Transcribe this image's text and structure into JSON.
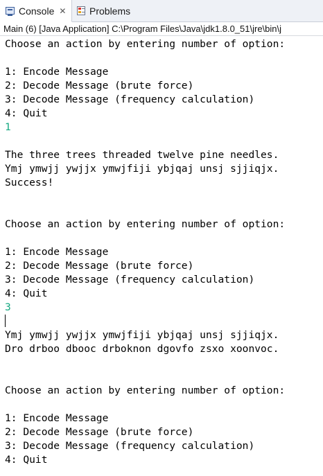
{
  "tabs": [
    {
      "label": "Console",
      "icon": "console-icon",
      "active": true,
      "closable": true
    },
    {
      "label": "Problems",
      "icon": "problems-icon",
      "active": false
    }
  ],
  "process_label": "Main (6) [Java Application] C:\\Program Files\\Java\\jdk1.8.0_51\\jre\\bin\\j",
  "colors": {
    "input_text": "#14a880",
    "output_text": "#000000"
  },
  "console": {
    "lines": [
      {
        "text": "Choose an action by entering number of option:",
        "type": "output"
      },
      {
        "text": "",
        "type": "output"
      },
      {
        "text": "1: Encode Message",
        "type": "output"
      },
      {
        "text": "2: Decode Message (brute force)",
        "type": "output"
      },
      {
        "text": "3: Decode Message (frequency calculation)",
        "type": "output"
      },
      {
        "text": "4: Quit",
        "type": "output"
      },
      {
        "text": "1",
        "type": "input"
      },
      {
        "text": "",
        "type": "output"
      },
      {
        "text": "The three trees threaded twelve pine needles.",
        "type": "output"
      },
      {
        "text": "Ymj ymwjj ywjjx ymwjfiji ybjqaj unsj sjjiqjx.",
        "type": "output"
      },
      {
        "text": "Success!",
        "type": "output"
      },
      {
        "text": "",
        "type": "output"
      },
      {
        "text": "",
        "type": "output"
      },
      {
        "text": "Choose an action by entering number of option:",
        "type": "output"
      },
      {
        "text": "",
        "type": "output"
      },
      {
        "text": "1: Encode Message",
        "type": "output"
      },
      {
        "text": "2: Decode Message (brute force)",
        "type": "output"
      },
      {
        "text": "3: Decode Message (frequency calculation)",
        "type": "output"
      },
      {
        "text": "4: Quit",
        "type": "output"
      },
      {
        "text": "3",
        "type": "input"
      },
      {
        "text": "",
        "type": "caret"
      },
      {
        "text": "Ymj ymwjj ywjjx ymwjfiji ybjqaj unsj sjjiqjx.",
        "type": "output"
      },
      {
        "text": "Dro drboo dbooc drboknon dgovfo zsxo xoonvoc.",
        "type": "output"
      },
      {
        "text": "",
        "type": "output"
      },
      {
        "text": "",
        "type": "output"
      },
      {
        "text": "Choose an action by entering number of option:",
        "type": "output"
      },
      {
        "text": "",
        "type": "output"
      },
      {
        "text": "1: Encode Message",
        "type": "output"
      },
      {
        "text": "2: Decode Message (brute force)",
        "type": "output"
      },
      {
        "text": "3: Decode Message (frequency calculation)",
        "type": "output"
      },
      {
        "text": "4: Quit",
        "type": "output"
      }
    ]
  }
}
